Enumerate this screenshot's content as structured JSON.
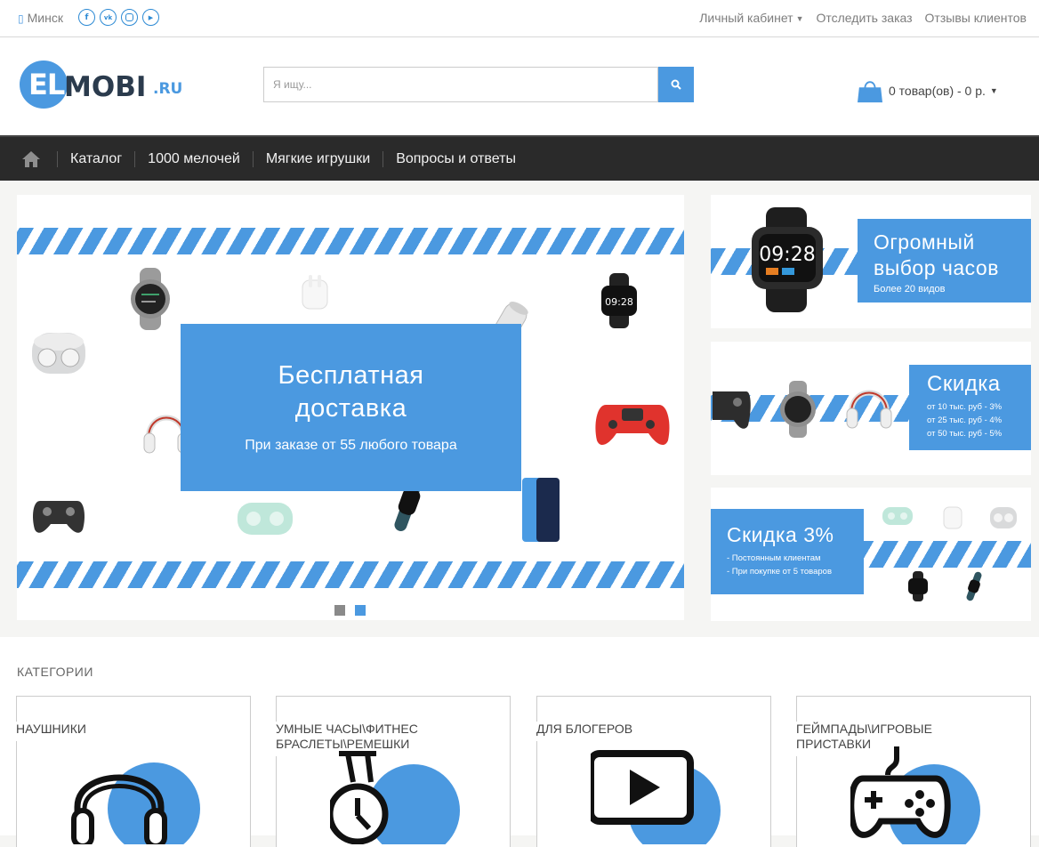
{
  "topbar": {
    "city": "Минск",
    "socials": [
      "f",
      "vk",
      "ig",
      "▶"
    ],
    "links": [
      "Личный кабинет",
      "Отследить заказ",
      "Отзывы клиентов"
    ]
  },
  "header": {
    "logo_el": "EL",
    "logo_mobi": "MOBI",
    "logo_ru": ".RU",
    "search_placeholder": "Я ищу...",
    "cart_text": "0 товар(ов) - 0 р."
  },
  "nav": {
    "items": [
      "Каталог",
      "1000 мелочей",
      "Мягкие игрушки",
      "Вопросы и ответы"
    ]
  },
  "slider": {
    "title": "Бесплатная доставка",
    "title_line1": "Бесплатная",
    "title_line2": "доставка",
    "subtitle": "При заказе от 55 любого товара",
    "active_slide": 2,
    "slide_count": 2
  },
  "side_banners": [
    {
      "title_line1": "Огромный",
      "title_line2": "выбор часов",
      "note": "Более 20 видов",
      "watch_time": "09:28"
    },
    {
      "title": "Скидка",
      "lines": [
        "от 10 тыс. руб - 3%",
        "от 25 тыс. руб - 4%",
        "от 50 тыс. руб - 5%"
      ]
    },
    {
      "title": "Скидка 3%",
      "lines": [
        "- Постоянным клиентам",
        "- При покупке от 5 товаров"
      ]
    }
  ],
  "categories": {
    "title": "КАТЕГОРИИ",
    "items": [
      {
        "label_line1": "НАУШНИКИ",
        "label_line2": "",
        "icon": "headphones-icon"
      },
      {
        "label_line1": "УМНЫЕ ЧАСЫ\\ФИТНЕС",
        "label_line2": "БРАСЛЕТЫ\\РЕМЕШКИ",
        "icon": "watch-icon"
      },
      {
        "label_line1": "ДЛЯ БЛОГЕРОВ",
        "label_line2": "",
        "icon": "video-play-icon"
      },
      {
        "label_line1": "ГЕЙМПАДЫ\\ИГРОВЫЕ ПРИСТАВКИ",
        "label_line2": "",
        "icon": "gamepad-icon"
      }
    ]
  },
  "colors": {
    "accent": "#4b99e0",
    "nav_bg": "#2a2a2a",
    "dark_text": "#2b3b4d"
  }
}
